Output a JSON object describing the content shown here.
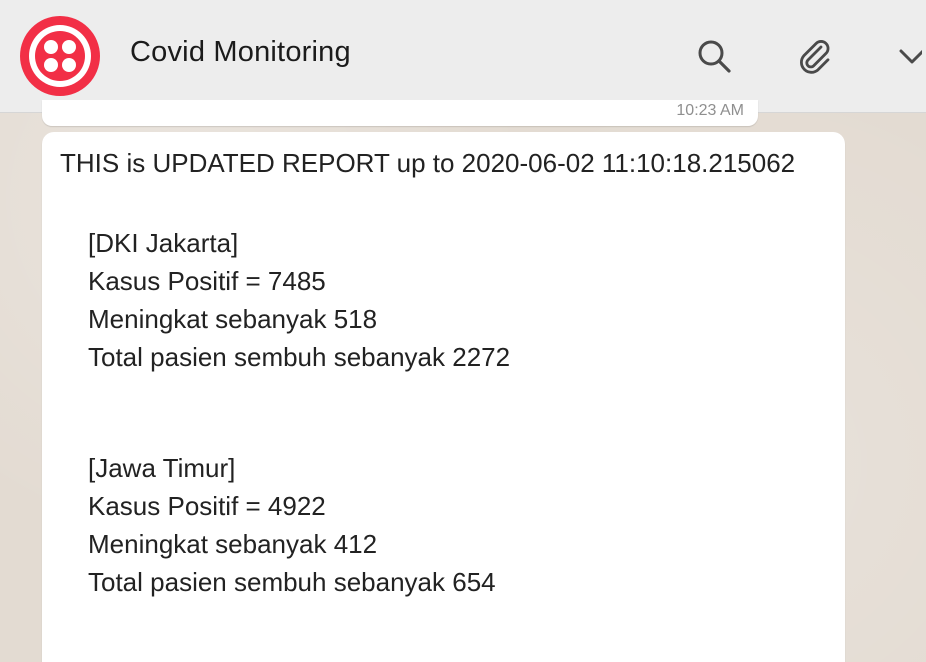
{
  "header": {
    "title": "Covid Monitoring",
    "icons": [
      "twilio-logo-icon",
      "search-icon",
      "paperclip-icon",
      "chevron-down-icon"
    ]
  },
  "previous_message": {
    "time": "10:23 AM"
  },
  "message": {
    "heading": "THIS is UPDATED REPORT up to 2020-06-02 11:10:18.215062",
    "regions": [
      {
        "name": "[DKI Jakarta]",
        "positive": "Kasus Positif = 7485",
        "increase": "Meningkat sebanyak 518",
        "recovered": "Total pasien sembuh sebanyak 2272"
      },
      {
        "name": "[Jawa Timur]",
        "positive": "Kasus Positif = 4922",
        "increase": "Meningkat sebanyak 412",
        "recovered": "Total pasien sembuh sebanyak 654"
      }
    ]
  },
  "colors": {
    "brand": "#f22f46",
    "header_bg": "#ededed",
    "chat_bg": "#e3dbd2",
    "bubble_bg": "#ffffff",
    "icon": "#4a4a4a"
  }
}
